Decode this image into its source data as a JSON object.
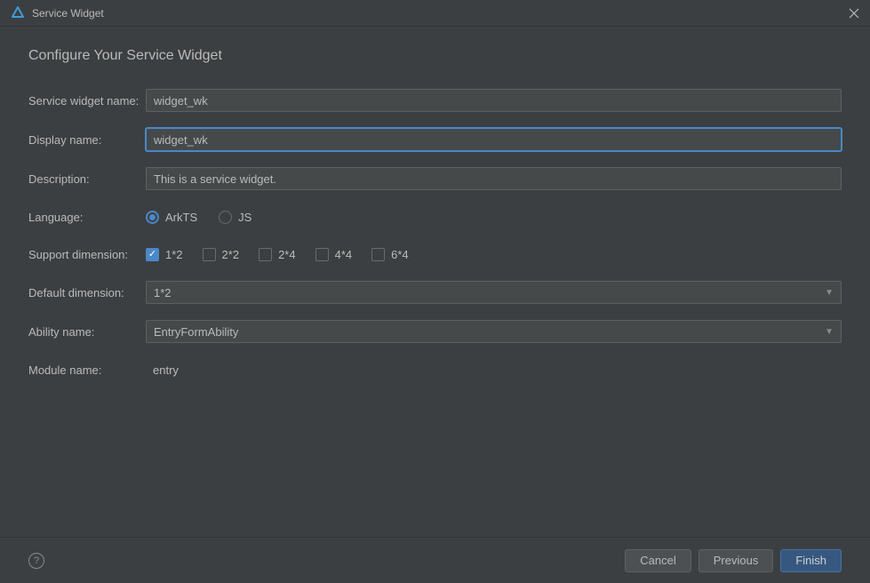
{
  "window": {
    "title": "Service Widget"
  },
  "heading": "Configure Your Service Widget",
  "form": {
    "widget_name": {
      "label": "Service widget name:",
      "value": "widget_wk"
    },
    "display_name": {
      "label": "Display name:",
      "value": "widget_wk"
    },
    "description": {
      "label": "Description:",
      "value": "This is a service widget."
    },
    "language": {
      "label": "Language:",
      "options": [
        {
          "label": "ArkTS",
          "selected": true
        },
        {
          "label": "JS",
          "selected": false
        }
      ]
    },
    "support_dimension": {
      "label": "Support dimension:",
      "options": [
        {
          "label": "1*2",
          "checked": true
        },
        {
          "label": "2*2",
          "checked": false
        },
        {
          "label": "2*4",
          "checked": false
        },
        {
          "label": "4*4",
          "checked": false
        },
        {
          "label": "6*4",
          "checked": false
        }
      ]
    },
    "default_dimension": {
      "label": "Default dimension:",
      "value": "1*2"
    },
    "ability_name": {
      "label": "Ability name:",
      "value": "EntryFormAbility"
    },
    "module_name": {
      "label": "Module name:",
      "value": "entry"
    }
  },
  "buttons": {
    "cancel": "Cancel",
    "previous": "Previous",
    "finish": "Finish"
  }
}
